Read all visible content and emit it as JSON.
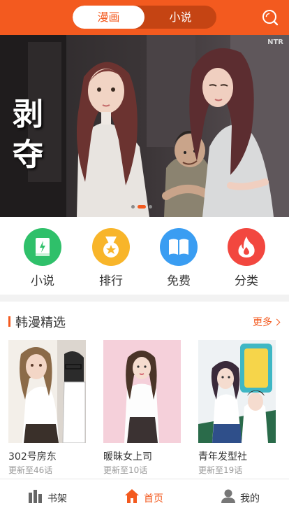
{
  "header": {
    "tabs": [
      {
        "label": "漫画",
        "active": true
      },
      {
        "label": "小说",
        "active": false
      }
    ],
    "search_icon": "search-icon",
    "accent": "#f35a1f"
  },
  "banner": {
    "title": "剥夺",
    "tag": "NTR",
    "slides": 3,
    "active_slide": 2
  },
  "categories": [
    {
      "label": "小说",
      "icon": "book-icon",
      "color": "#2fc06a"
    },
    {
      "label": "排行",
      "icon": "medal-icon",
      "color": "#f8b52a"
    },
    {
      "label": "免费",
      "icon": "open-book-icon",
      "color": "#3a9df2"
    },
    {
      "label": "分类",
      "icon": "flame-icon",
      "color": "#f2473f"
    }
  ],
  "section": {
    "title": "韩漫精选",
    "more_label": "更多"
  },
  "books": [
    {
      "title": "302号房东",
      "sub": "更新至46话"
    },
    {
      "title": "暖昧女上司",
      "sub": "更新至10话"
    },
    {
      "title": "青年发型社",
      "sub": "更新至19话"
    }
  ],
  "nav": [
    {
      "label": "书架",
      "icon": "bookshelf-icon",
      "active": false
    },
    {
      "label": "首页",
      "icon": "home-icon",
      "active": true
    },
    {
      "label": "我的",
      "icon": "user-icon",
      "active": false
    }
  ]
}
